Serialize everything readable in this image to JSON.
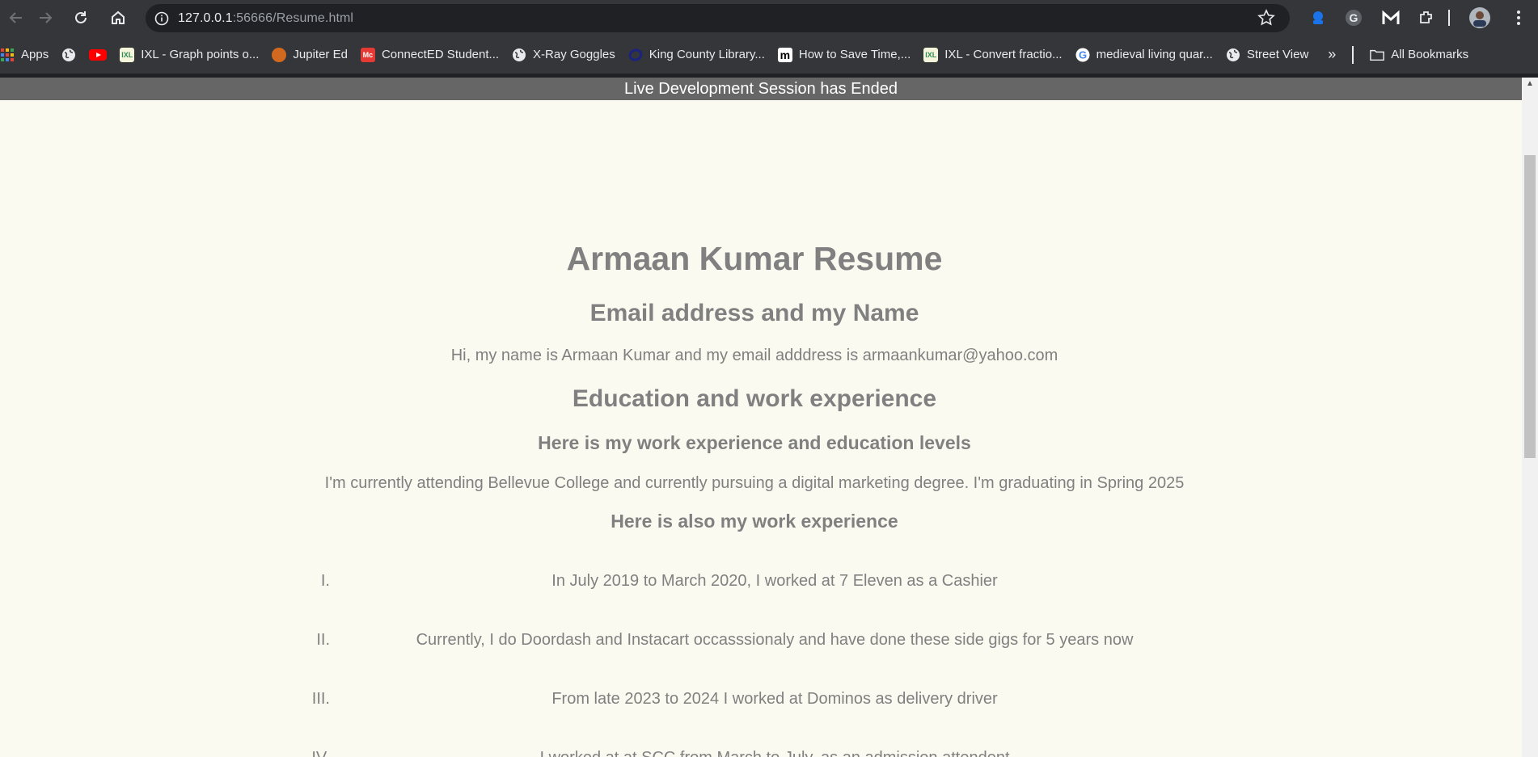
{
  "browser": {
    "url_host": "127.0.0.1",
    "url_rest": ":56666/Resume.html",
    "icons": [
      "back-icon",
      "forward-icon",
      "reload-icon",
      "home-icon",
      "info-icon",
      "star-icon",
      "extensions-icon",
      "profile-icon",
      "menu-icon"
    ]
  },
  "bookmarks": {
    "items": [
      {
        "label": "Apps"
      },
      {
        "label": ""
      },
      {
        "label": ""
      },
      {
        "label": "IXL - Graph points o..."
      },
      {
        "label": "Jupiter Ed"
      },
      {
        "label": "ConnectED Student..."
      },
      {
        "label": "X-Ray Goggles"
      },
      {
        "label": "King County Library..."
      },
      {
        "label": "How to Save Time,..."
      },
      {
        "label": "IXL - Convert fractio..."
      },
      {
        "label": "medieval living quar..."
      },
      {
        "label": "Street View"
      }
    ],
    "overflow": "»",
    "all_bookmarks": "All Bookmarks"
  },
  "page": {
    "banner": "Live Development Session has Ended",
    "title": "Armaan Kumar Resume",
    "section1_heading": "Email address and my Name",
    "section1_text": "Hi, my name is Armaan Kumar and my email adddress is armaankumar@yahoo.com",
    "section2_heading": "Education and work experience",
    "section2_subheading": "Here is my work experience and education levels",
    "section2_text": "I'm currently attending Bellevue College and currently pursuing a digital marketing degree. I'm graduating in Spring 2025",
    "section3_subheading": "Here is also my work experience",
    "work_items": [
      {
        "num": "I.",
        "text": "In July 2019 to March 2020, I worked at 7 Eleven as a Cashier"
      },
      {
        "num": "II.",
        "text": "Currently, I do Doordash and Instacart occasssionaly and have done these side gigs for 5 years now"
      },
      {
        "num": "III.",
        "text": "From late 2023 to 2024 I worked at Dominos as delivery driver"
      },
      {
        "num": "IV.",
        "text": "I worked at at SCC from March to July, as an admission attendent"
      }
    ]
  }
}
